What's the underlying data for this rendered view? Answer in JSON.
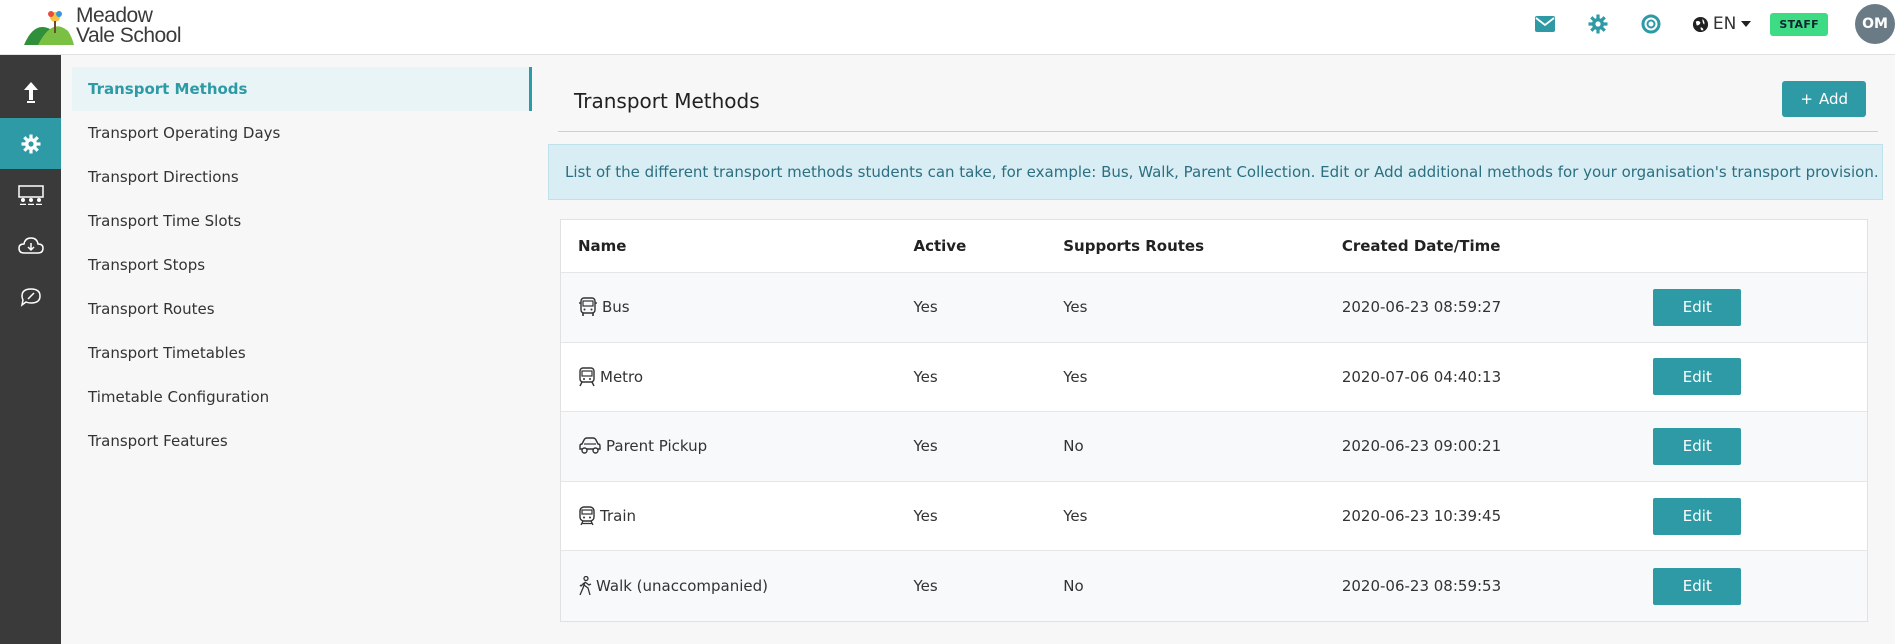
{
  "brand": {
    "line1": "Meadow",
    "line2": "Vale School",
    "accent": "#2e9aa5",
    "badge_color": "#3ddc84"
  },
  "header": {
    "language": "EN",
    "role_badge": "STAFF",
    "avatar_initials": "OM"
  },
  "rail": {
    "items": [
      "upload-icon",
      "gear-icon",
      "classroom-icon",
      "cloud-download-icon",
      "chat-icon"
    ],
    "active_index": 1
  },
  "subnav": {
    "items": [
      "Transport Methods",
      "Transport Operating Days",
      "Transport Directions",
      "Transport Time Slots",
      "Transport Stops",
      "Transport Routes",
      "Transport Timetables",
      "Timetable Configuration",
      "Transport Features"
    ],
    "active_index": 0
  },
  "page": {
    "title": "Transport Methods",
    "add_label": "Add",
    "info": "List of the different transport methods students can take, for example: Bus, Walk, Parent Collection. Edit or Add additional methods for your organisation's transport provision."
  },
  "table": {
    "columns": [
      "Name",
      "Active",
      "Supports Routes",
      "Created Date/Time"
    ],
    "edit_label": "Edit",
    "rows": [
      {
        "icon": "bus-icon",
        "name": "Bus",
        "active": "Yes",
        "routes": "Yes",
        "created": "2020-06-23 08:59:27"
      },
      {
        "icon": "metro-icon",
        "name": "Metro",
        "active": "Yes",
        "routes": "Yes",
        "created": "2020-07-06 04:40:13"
      },
      {
        "icon": "car-icon",
        "name": "Parent Pickup",
        "active": "Yes",
        "routes": "No",
        "created": "2020-06-23 09:00:21"
      },
      {
        "icon": "train-icon",
        "name": "Train",
        "active": "Yes",
        "routes": "Yes",
        "created": "2020-06-23 10:39:45"
      },
      {
        "icon": "walk-icon",
        "name": "Walk (unaccompanied)",
        "active": "Yes",
        "routes": "No",
        "created": "2020-06-23 08:59:53"
      }
    ]
  }
}
